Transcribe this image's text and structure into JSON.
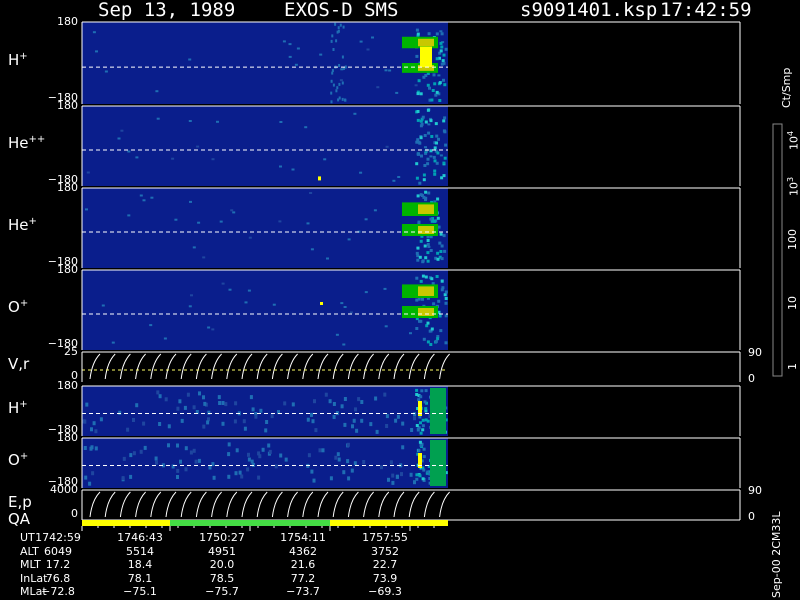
{
  "header": {
    "date": "Sep 13, 1989",
    "instrument": "EXOS-D SMS",
    "file": "s9091401.ksp",
    "time": "17:42:59"
  },
  "chart_data": {
    "type": "heatmap",
    "panels": [
      {
        "id": "hplus",
        "label": "H",
        "sup": "+",
        "ytop": "180",
        "ybot": "−180",
        "kind": "heat"
      },
      {
        "id": "heplus2",
        "label": "He",
        "sup": "++",
        "ytop": "180",
        "ybot": "−180",
        "kind": "heat"
      },
      {
        "id": "heplus",
        "label": "He",
        "sup": "+",
        "ytop": "180",
        "ybot": "−180",
        "kind": "heat"
      },
      {
        "id": "oplus",
        "label": "O",
        "sup": "+",
        "ytop": "180",
        "ybot": "−180",
        "kind": "heat"
      },
      {
        "id": "vr",
        "label": "V,r",
        "sup": "",
        "ytop": "25",
        "ybot": "0",
        "kind": "line",
        "rtop": "90",
        "rbot": "0"
      },
      {
        "id": "hplus_b",
        "label": "H",
        "sup": "+",
        "ytop": "180",
        "ybot": "−180",
        "kind": "heat"
      },
      {
        "id": "oplus_b",
        "label": "O",
        "sup": "+",
        "ytop": "180",
        "ybot": "−180",
        "kind": "heat"
      },
      {
        "id": "ep",
        "label": "E,p",
        "sup": "",
        "ytop": "4000",
        "ybot": "0",
        "kind": "line",
        "rtop": "90",
        "rbot": "0"
      }
    ],
    "qa_label": "QA",
    "qa_segments": [
      {
        "from": "17:42:59",
        "to": "17:47:30",
        "color": "#ffff00"
      },
      {
        "from": "17:47:30",
        "to": "17:54:11",
        "color": "#44dd44"
      },
      {
        "from": "17:54:11",
        "to": "18:00:00",
        "color": "#ffff00"
      }
    ],
    "colorbar": {
      "units": "Ct/Smp",
      "labels": [
        "10",
        "10",
        "100",
        "10",
        "1"
      ],
      "label_sups": [
        "4",
        "3",
        "",
        "",
        ""
      ],
      "colors": [
        "#ffffff",
        "#5a0000",
        "#7a0000",
        "#990000",
        "#b30000",
        "#cc0000",
        "#e00000",
        "#ff0000",
        "#8b5a00",
        "#8a7000",
        "#7a8a00",
        "#a0a000",
        "#c8c800",
        "#e6e600",
        "#ffff00",
        "#b4e600",
        "#78dc00",
        "#3cc800",
        "#00b400",
        "#00a050",
        "#00b4b4",
        "#20c8d0",
        "#00a0b4",
        "#1e6eb4",
        "#1e46a0",
        "#0a1e8c",
        "#001478"
      ]
    },
    "orbit": {
      "rows": [
        {
          "name": "UT",
          "values": [
            "1742:59",
            "1746:43",
            "1750:27",
            "1754:11",
            "1757:55"
          ]
        },
        {
          "name": "ALT",
          "values": [
            "6049",
            "5514",
            "4951",
            "4362",
            "3752"
          ]
        },
        {
          "name": "MLT",
          "values": [
            "17.2",
            "18.4",
            "20.0",
            "21.6",
            "22.7"
          ]
        },
        {
          "name": "InLat",
          "values": [
            "76.8",
            "78.1",
            "78.5",
            "77.2",
            "73.9"
          ]
        },
        {
          "name": "MLat",
          "values": [
            "−72.8",
            "−75.1",
            "−75.7",
            "−73.7",
            "−69.3"
          ]
        }
      ]
    },
    "footer_id": "Sep-00 2CM33L"
  },
  "colors": {
    "background": "#000000",
    "plot_bg": "#0a1e8c",
    "axis": "#ffffff",
    "trace": "#ffff66"
  }
}
